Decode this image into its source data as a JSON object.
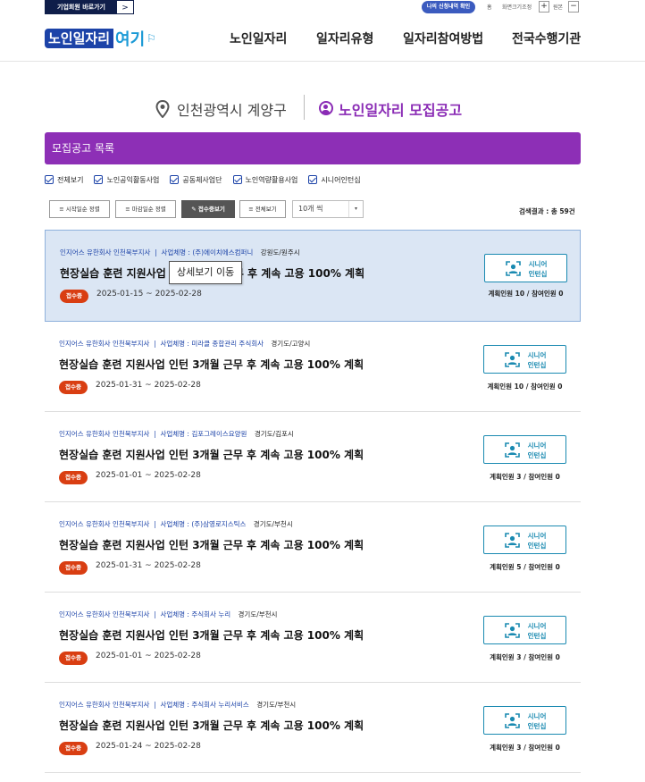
{
  "topbar": {
    "corp_link": "기업회원 바로가기",
    "corp_arrow": ">",
    "myinfo": "나의 신청내역 확인",
    "home": "홈",
    "font_size": "화면크기조정",
    "zoom_in": "+",
    "original": "원본",
    "zoom_out": "−"
  },
  "header": {
    "logo_main": "노인일자리",
    "logo_sub": "여기",
    "nav": [
      "노인일자리",
      "일자리유형",
      "일자리참여방법",
      "전국수행기관"
    ]
  },
  "location": {
    "region": "인천광역시 계양구",
    "title": "노인일자리 모집공고"
  },
  "section": {
    "title": "모집공고 목록"
  },
  "filters": [
    "전체보기",
    "노인공익활동사업",
    "공동체사업단",
    "노인역량활용사업",
    "시니어인턴십"
  ],
  "sort": {
    "buttons": [
      "≡ 시작일순 정렬",
      "≡ 마감일순 정렬",
      "✎ 접수중보기",
      "≡ 전체보기"
    ],
    "per_page": "10개 씩",
    "caret": "▾",
    "result": "검색결과 : 총 59건"
  },
  "tooltip": "상세보기 이동",
  "items": [
    {
      "org": "인지어스 유한회사 인천북부지사",
      "company": "사업체명 : (주)에이치에스컴퍼니",
      "region": "강원도/원주시",
      "title": "현장실습 훈련 지원사업 인턴 3개월 근무 후 계속 고용 100% 계획",
      "badge": "접수중",
      "period": "2025-01-15 ~ 2025-02-28",
      "type": "시니어 인턴십",
      "headcount": "계획인원 10 / 참여인원 0"
    },
    {
      "org": "인지어스 유한회사 인천북부지사",
      "company": "사업체명 : 미라클 종합관리 주식회사",
      "region": "경기도/고양시",
      "title": "현장실습 훈련 지원사업 인턴 3개월 근무 후 계속 고용 100% 계획",
      "badge": "접수중",
      "period": "2025-01-31 ~ 2025-02-28",
      "type": "시니어 인턴십",
      "headcount": "계획인원 10 / 참여인원 0"
    },
    {
      "org": "인지어스 유한회사 인천북부지사",
      "company": "사업체명 : 김포그레이스요양원",
      "region": "경기도/김포시",
      "title": "현장실습 훈련 지원사업 인턴 3개월 근무 후 계속 고용 100% 계획",
      "badge": "접수중",
      "period": "2025-01-01 ~ 2025-02-28",
      "type": "시니어 인턴십",
      "headcount": "계획인원 3 / 참여인원 0"
    },
    {
      "org": "인지어스 유한회사 인천북부지사",
      "company": "사업체명 : (주)삼영로지스틱스",
      "region": "경기도/부천시",
      "title": "현장실습 훈련 지원사업 인턴 3개월 근무 후 계속 고용 100% 계획",
      "badge": "접수중",
      "period": "2025-01-31 ~ 2025-02-28",
      "type": "시니어 인턴십",
      "headcount": "계획인원 5 / 참여인원 0"
    },
    {
      "org": "인지어스 유한회사 인천북부지사",
      "company": "사업체명 : 주식회사 누리",
      "region": "경기도/부천시",
      "title": "현장실습 훈련 지원사업 인턴 3개월 근무 후 계속 고용 100% 계획",
      "badge": "접수중",
      "period": "2025-01-01 ~ 2025-02-28",
      "type": "시니어 인턴십",
      "headcount": "계획인원 3 / 참여인원 0"
    },
    {
      "org": "인지어스 유한회사 인천북부지사",
      "company": "사업체명 : 주식회사 누리서비스",
      "region": "경기도/부천시",
      "title": "현장실습 훈련 지원사업 인턴 3개월 근무 후 계속 고용 100% 계획",
      "badge": "접수중",
      "period": "2025-01-24 ~ 2025-02-28",
      "type": "시니어 인턴십",
      "headcount": "계획인원 3 / 참여인원 0"
    }
  ],
  "colors": {
    "brand_blue": "#1c43a8",
    "purple": "#8d2fb6",
    "badge": "#d93e12",
    "teal": "#1a8ab1"
  }
}
